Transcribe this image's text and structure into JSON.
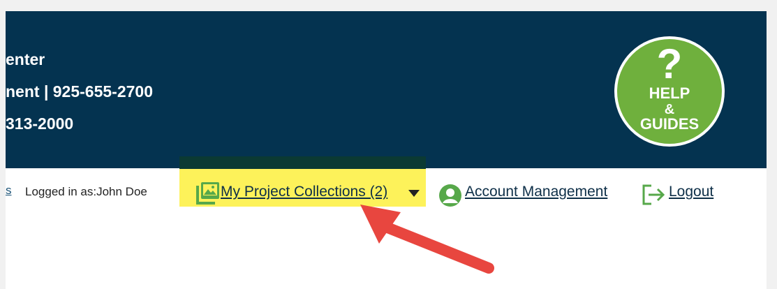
{
  "header": {
    "line1": "enter",
    "line2": "nent | 925-655-2700",
    "line3": "313-2000",
    "help": {
      "symbol": "?",
      "line1": "HELP",
      "line2": "&",
      "line3": "GUIDES"
    }
  },
  "nav": {
    "cut_link": "s",
    "logged_in": "Logged in as:John Doe",
    "collections": {
      "label": "My Project Collections (2)",
      "icon": "image-collection-icon"
    },
    "account": {
      "label": "Account Management",
      "icon": "user-circle-icon"
    },
    "logout": {
      "label": "Logout",
      "icon": "logout-arrow-icon"
    }
  },
  "colors": {
    "header_bg": "#043350",
    "help_bg": "#6fb03d",
    "highlight": "#fdf25a",
    "accent_green": "#57a84a",
    "arrow_red": "#e8463f"
  }
}
